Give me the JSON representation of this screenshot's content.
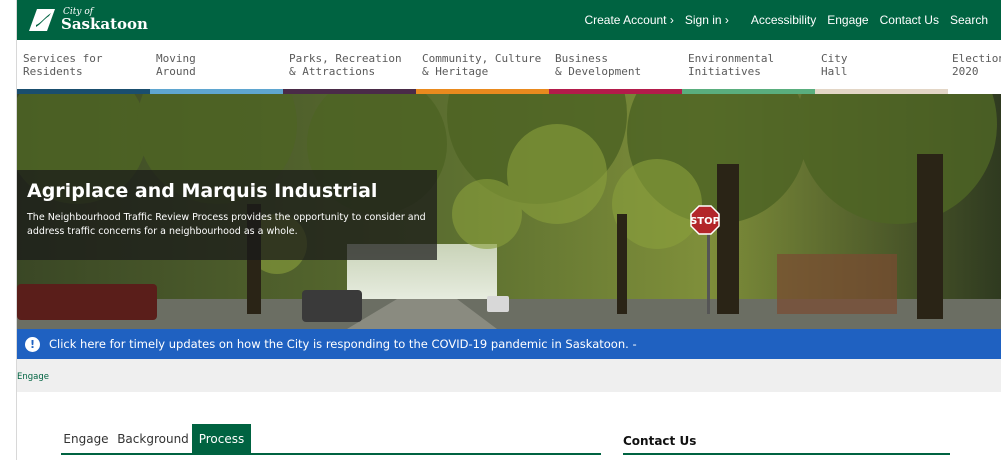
{
  "brand": {
    "logo_small": "City of",
    "logo_big": "Saskatoon"
  },
  "top_links": {
    "create_account": "Create Account ›",
    "sign_in": "Sign in ›",
    "accessibility": "Accessibility",
    "engage": "Engage",
    "contact_us": "Contact Us",
    "search": "Search"
  },
  "nav": [
    {
      "line1": "Services for",
      "line2": "Residents",
      "color": "#1a4e6e"
    },
    {
      "line1": "Moving",
      "line2": "Around",
      "color": "#5fa6d0"
    },
    {
      "line1": "Parks, Recreation",
      "line2": "& Attractions",
      "color": "#4a2b48"
    },
    {
      "line1": "Community, Culture",
      "line2": "& Heritage",
      "color": "#e98a1e"
    },
    {
      "line1": "Business",
      "line2": "& Development",
      "color": "#b31b4b"
    },
    {
      "line1": "Environmental",
      "line2": "Initiatives",
      "color": "#5aae7e"
    },
    {
      "line1": "City",
      "line2": "Hall",
      "color": "#e3d6c6"
    },
    {
      "line1": "Election",
      "line2": "2020",
      "color": "#ffffff"
    }
  ],
  "hero": {
    "title": "Agriplace and Marquis Industrial",
    "description": "The Neighbourhood Traffic Review Process provides the opportunity to consider and address traffic concerns for a neighbourhood as a whole.",
    "stop_sign": "STOP"
  },
  "alert": {
    "icon": "!",
    "text": "Click here for timely updates on how the City is responding to the COVID-19 pandemic in Saskatoon. -"
  },
  "breadcrumb": "Engage",
  "tabs": [
    "Engage",
    "Background",
    "Process"
  ],
  "active_tab": "Process",
  "contact": {
    "title": "Contact Us"
  },
  "colors": {
    "brand_green": "#006341",
    "alert_blue": "#1f61c1"
  }
}
